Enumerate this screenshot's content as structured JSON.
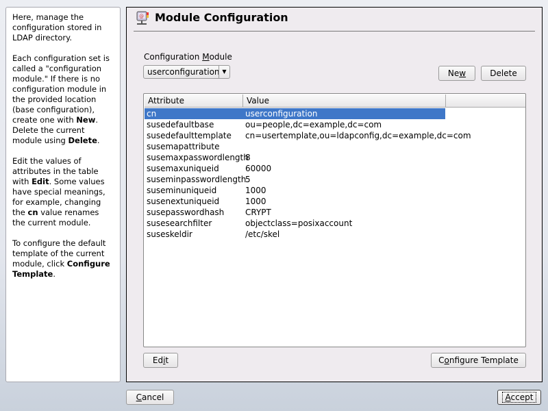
{
  "help": {
    "p1": "Here, manage the configuration stored in LDAP directory.",
    "p2a": "Each configuration set is called a \"configuration module.\" If there is no configuration module in the provided location (base configuration), create one with ",
    "p2b": "New",
    "p2c": ". Delete the current module using ",
    "p2d": "Delete",
    "p2e": ".",
    "p3a": "Edit the values of attributes in the table with ",
    "p3b": "Edit",
    "p3c": ". Some values have special meanings, for example, changing the ",
    "p3d": "cn",
    "p3e": " value renames the current module.",
    "p4a": "To configure the default template of the current module, click ",
    "p4b": "Configure Template",
    "p4c": "."
  },
  "title": "Module Configuration",
  "module_label": {
    "pre": "Configuration ",
    "u": "M",
    "post": "odule"
  },
  "module_value": "userconfiguration",
  "buttons": {
    "new": {
      "pre": "Ne",
      "u": "w",
      "post": ""
    },
    "delete": {
      "pre": "Delete",
      "u": "",
      "post": ""
    },
    "edit": {
      "pre": "Ed",
      "u": "i",
      "post": "t"
    },
    "configure": {
      "pre": "C",
      "u": "o",
      "post": "nfigure Template"
    },
    "cancel": {
      "pre": "",
      "u": "C",
      "post": "ancel"
    },
    "accept": {
      "pre": "",
      "u": "A",
      "post": "ccept"
    }
  },
  "table": {
    "columns": [
      "Attribute",
      "Value"
    ],
    "rows": [
      [
        "cn",
        "userconfiguration"
      ],
      [
        "susedefaultbase",
        "ou=people,dc=example,dc=com"
      ],
      [
        "susedefaulttemplate",
        "cn=usertemplate,ou=ldapconfig,dc=example,dc=com"
      ],
      [
        "susemapattribute",
        ""
      ],
      [
        "susemaxpasswordlength",
        "8"
      ],
      [
        "susemaxuniqueid",
        "60000"
      ],
      [
        "suseminpasswordlength",
        "5"
      ],
      [
        "suseminuniqueid",
        "1000"
      ],
      [
        "susenextuniqueid",
        "1000"
      ],
      [
        "susepasswordhash",
        "CRYPT"
      ],
      [
        "susesearchfilter",
        "objectclass=posixaccount"
      ],
      [
        "suseskeldir",
        "/etc/skel"
      ]
    ]
  }
}
